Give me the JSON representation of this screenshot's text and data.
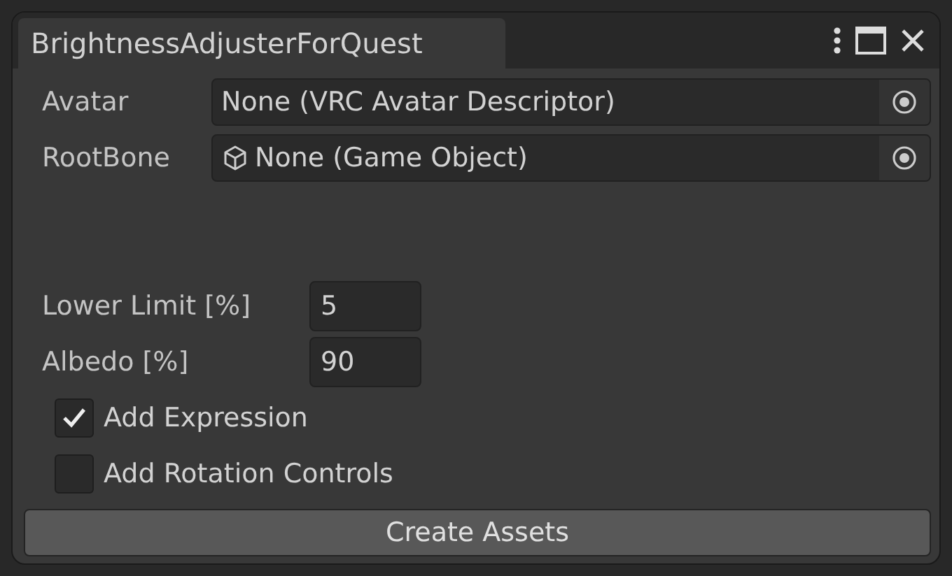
{
  "window": {
    "title": "BrightnessAdjusterForQuest"
  },
  "object_fields": [
    {
      "label": "Avatar",
      "value": "None (VRC Avatar Descriptor)",
      "kind": "plain"
    },
    {
      "label": "RootBone",
      "value": "None (Game Object)",
      "kind": "gameobject"
    }
  ],
  "number_fields": [
    {
      "label": "Lower Limit [%]",
      "value": "5"
    },
    {
      "label": "Albedo [%]",
      "value": "90"
    }
  ],
  "toggles": [
    {
      "label": "Add Expression",
      "checked": true
    },
    {
      "label": "Add Rotation Controls",
      "checked": false
    }
  ],
  "button": "Create Assets"
}
